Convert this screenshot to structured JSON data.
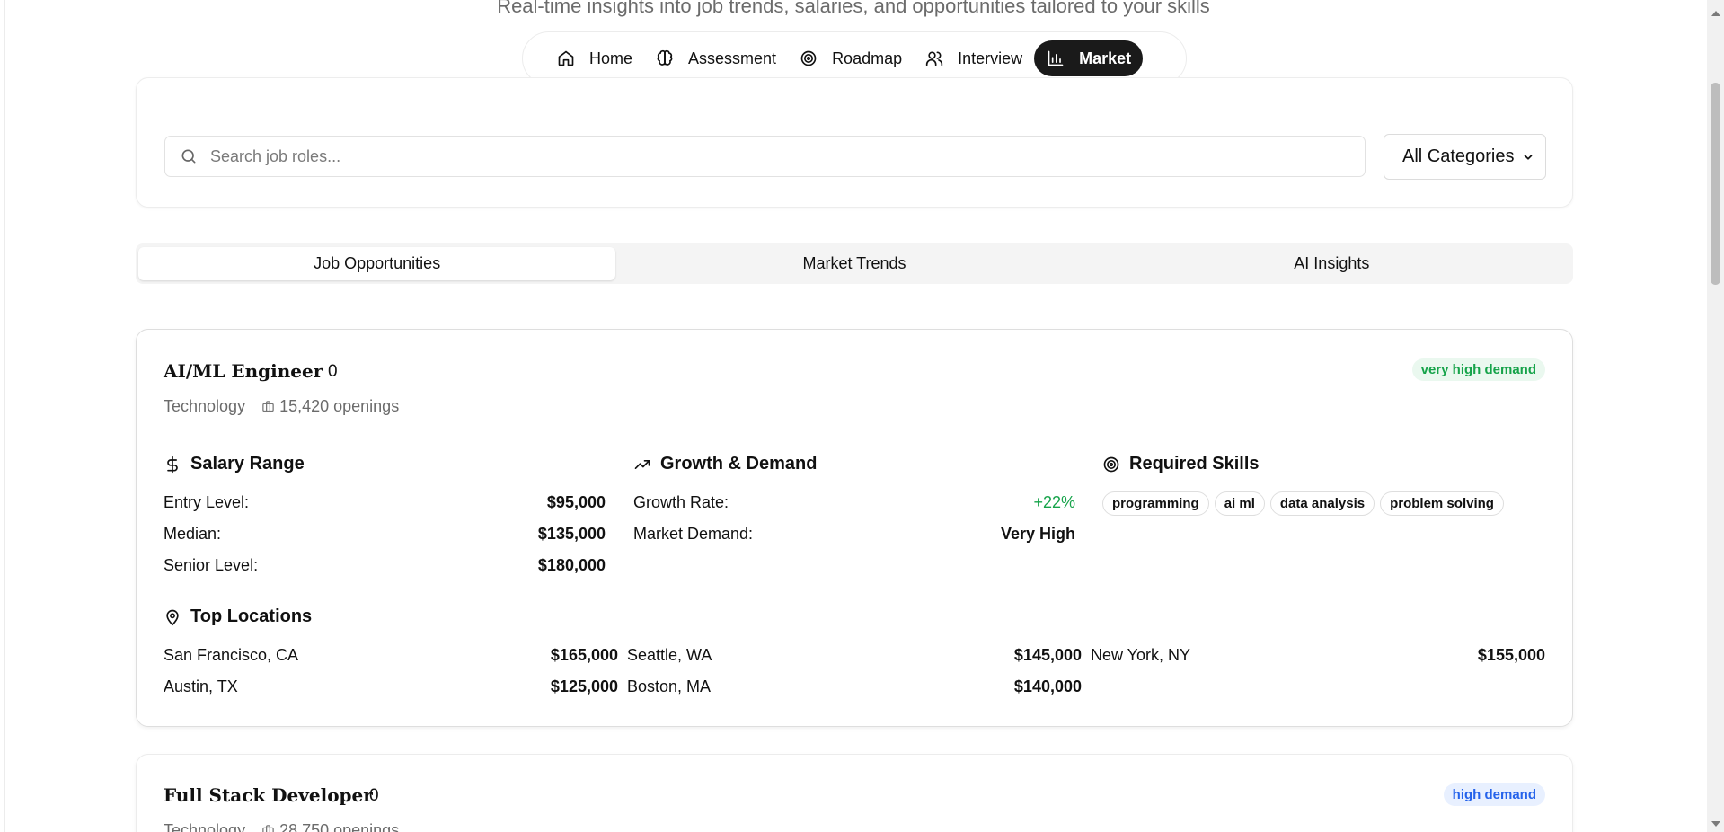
{
  "header": {
    "subtitle": "Real-time insights into job trends, salaries, and opportunities tailored to your skills"
  },
  "nav": {
    "items": [
      {
        "label": "Home",
        "icon": "home-icon",
        "active": false
      },
      {
        "label": "Assessment",
        "icon": "brain-icon",
        "active": false
      },
      {
        "label": "Roadmap",
        "icon": "target-icon",
        "active": false
      },
      {
        "label": "Interview",
        "icon": "users-icon",
        "active": false
      },
      {
        "label": "Market",
        "icon": "bar-chart-icon",
        "active": true
      }
    ]
  },
  "search": {
    "placeholder": "Search job roles...",
    "category": "All Categories"
  },
  "tabs": [
    {
      "label": "Job Opportunities",
      "active": true
    },
    {
      "label": "Market Trends",
      "active": false
    },
    {
      "label": "AI Insights",
      "active": false
    }
  ],
  "jobs": [
    {
      "title": "AI/ML Engineer",
      "count": "0",
      "category": "Technology",
      "openings": "15,420 openings",
      "demand": "very high demand",
      "salary": {
        "title": "Salary Range",
        "entry_label": "Entry Level:",
        "entry": "$95,000",
        "median_label": "Median:",
        "median": "$135,000",
        "senior_label": "Senior Level:",
        "senior": "$180,000"
      },
      "growth": {
        "title": "Growth & Demand",
        "rate_label": "Growth Rate:",
        "rate": "+22%",
        "demand_label": "Market Demand:",
        "demand": "Very High"
      },
      "skills": {
        "title": "Required Skills",
        "items": [
          "programming",
          "ai ml",
          "data analysis",
          "problem solving"
        ]
      },
      "locations": {
        "title": "Top Locations",
        "items": [
          {
            "city": "San Francisco, CA",
            "salary": "$165,000"
          },
          {
            "city": "Seattle, WA",
            "salary": "$145,000"
          },
          {
            "city": "New York, NY",
            "salary": "$155,000"
          },
          {
            "city": "Austin, TX",
            "salary": "$125,000"
          },
          {
            "city": "Boston, MA",
            "salary": "$140,000"
          }
        ]
      }
    },
    {
      "title": "Full Stack Developer",
      "count": "0",
      "category": "Technology",
      "openings": "28,750 openings",
      "demand": "high demand"
    }
  ],
  "colors": {
    "accent_dark": "#1a1a1a",
    "green": "#16a34a",
    "blue": "#2563eb"
  }
}
